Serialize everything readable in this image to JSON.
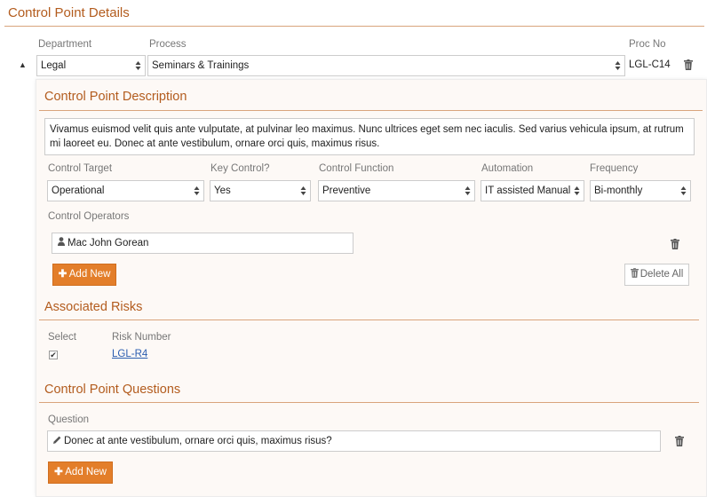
{
  "page_title": "Control Point Details",
  "header_row": {
    "department_label": "Department",
    "process_label": "Process",
    "proc_no_label": "Proc No",
    "department_value": "Legal",
    "process_value": "Seminars & Trainings",
    "proc_no_value": "LGL-C14"
  },
  "description": {
    "title": "Control Point Description",
    "text": "Vivamus euismod velit quis ante vulputate, at pulvinar leo maximus. Nunc ultrices eget sem nec iaculis. Sed varius vehicula ipsum, at rutrum mi laoreet eu. Donec at ante vestibulum, ornare orci quis, maximus risus."
  },
  "fields": {
    "control_target_label": "Control Target",
    "control_target_value": "Operational",
    "key_control_label": "Key Control?",
    "key_control_value": "Yes",
    "control_function_label": "Control Function",
    "control_function_value": "Preventive",
    "automation_label": "Automation",
    "automation_value": "IT assisted Manual",
    "frequency_label": "Frequency",
    "frequency_value": "Bi-monthly"
  },
  "operators": {
    "label": "Control Operators",
    "items": [
      "Mac John Gorean"
    ],
    "add_label": "Add New",
    "delete_all_label": "Delete All"
  },
  "risks": {
    "title": "Associated Risks",
    "select_label": "Select",
    "risk_number_label": "Risk Number",
    "items": [
      {
        "number": "LGL-R4",
        "checked": true
      }
    ]
  },
  "questions": {
    "title": "Control Point Questions",
    "question_label": "Question",
    "items": [
      "Donec at ante vestibulum, ornare orci quis, maximus risus?"
    ],
    "add_label": "Add New"
  },
  "colors": {
    "accent": "#e37e2a",
    "heading": "#b35c1e"
  }
}
